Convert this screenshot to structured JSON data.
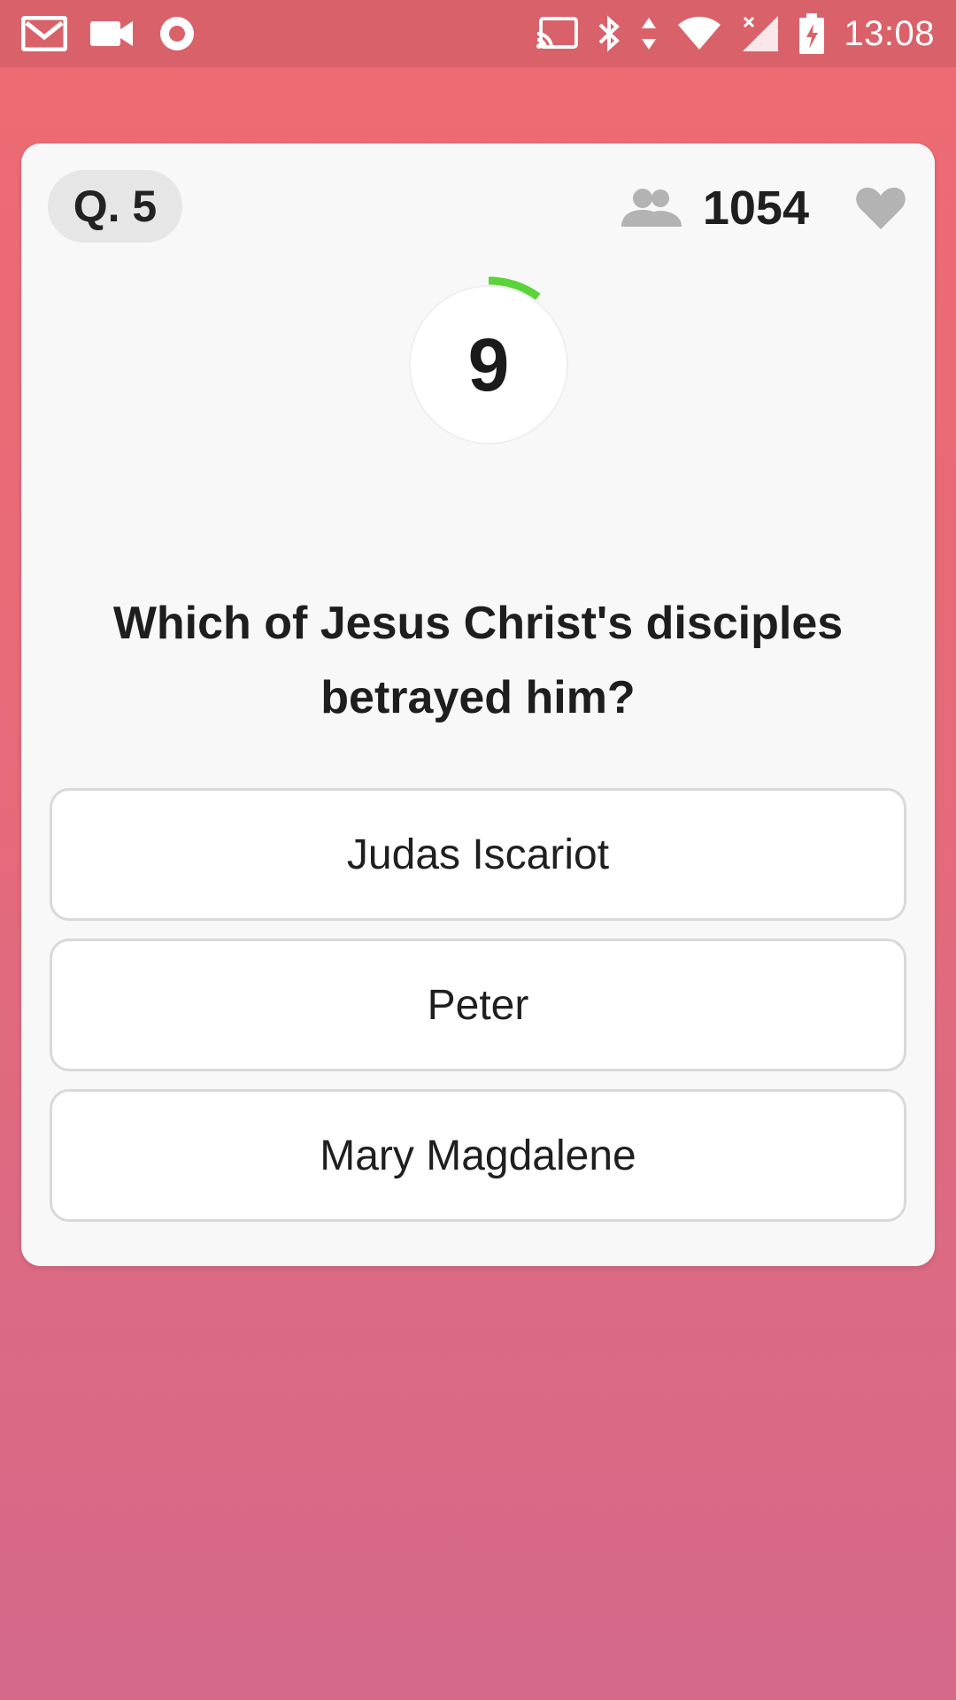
{
  "status_bar": {
    "time": "13:08",
    "left_icons": [
      "gmail-icon",
      "video-camera-icon",
      "record-icon"
    ],
    "right_icons": [
      "cast-icon",
      "bluetooth-icon",
      "data-arrows-icon",
      "wifi-icon",
      "signal-icon",
      "battery-charging-icon"
    ]
  },
  "quiz": {
    "question_number": "Q. 5",
    "player_count": "1054",
    "timer_value": "9",
    "timer_progress": 0.1,
    "question": "Which of Jesus Christ's disciples betrayed him?",
    "answers": [
      {
        "label": "Judas Iscariot"
      },
      {
        "label": "Peter"
      },
      {
        "label": "Mary Magdalene"
      }
    ]
  },
  "colors": {
    "background_top": "#ee6b72",
    "background_bottom": "#d4698a",
    "timer_arc": "#5bd33a",
    "card": "#f8f8f8"
  }
}
